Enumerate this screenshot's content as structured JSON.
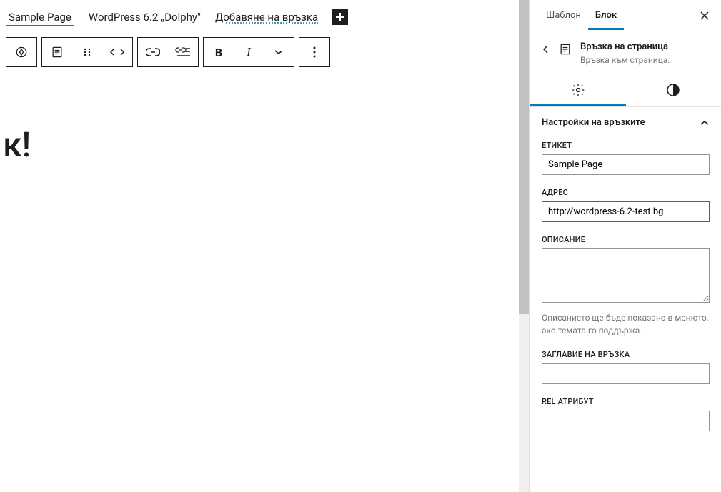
{
  "nav": {
    "items": [
      {
        "label": "Sample Page",
        "selected": true
      },
      {
        "label": "WordPress 6.2 „Dolphy\"",
        "selected": false
      },
      {
        "label": "Добавяне на връзка",
        "selected": false,
        "dotted": true
      }
    ]
  },
  "content": {
    "text": "к!"
  },
  "sidebar": {
    "tabs": [
      {
        "label": "Шаблон",
        "active": false
      },
      {
        "label": "Блок",
        "active": true
      }
    ],
    "block": {
      "title": "Връзка на страница",
      "description": "Връзка към страница."
    },
    "panel": {
      "title": "Настройки на връзките"
    },
    "fields": {
      "label": {
        "title": "ЕТИКЕТ",
        "value": "Sample Page"
      },
      "url": {
        "title": "АДРЕС",
        "value": "http://wordpress-6.2-test.bg"
      },
      "description": {
        "title": "ОПИСАНИЕ",
        "value": "",
        "help": "Описанието ще бъде показано в менюто, ако темата го поддържа."
      },
      "linktitle": {
        "title": "ЗАГЛАВИЕ НА ВРЪЗКА",
        "value": ""
      },
      "rel": {
        "title": "REL АТРИБУТ",
        "value": ""
      }
    }
  }
}
